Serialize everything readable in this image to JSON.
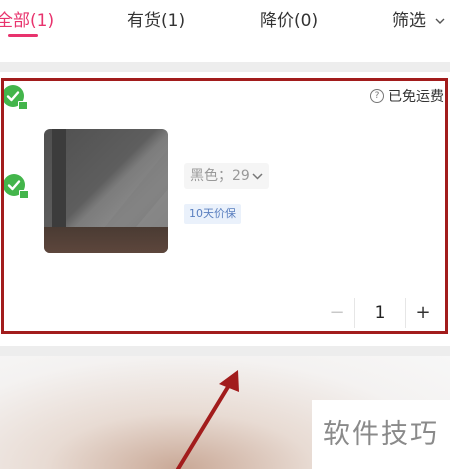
{
  "tabs": [
    {
      "label": "全部(1)",
      "active": true
    },
    {
      "label": "有货(1)",
      "active": false
    },
    {
      "label": "降价(0)",
      "active": false
    },
    {
      "label": "筛选",
      "active": false
    }
  ],
  "colors": {
    "accent": "#e8336d",
    "check": "#43b54b",
    "highlight_frame": "#a21c1c",
    "tag_text": "#5a7fbf"
  },
  "card": {
    "shipping_label": "已免运费",
    "shipping_icon": "question-circle-icon",
    "sku_label": "黑色；29",
    "tag_label": "10天价保",
    "quantity": "1",
    "minus_label": "−",
    "plus_label": "+"
  },
  "watermark": "软件技巧"
}
